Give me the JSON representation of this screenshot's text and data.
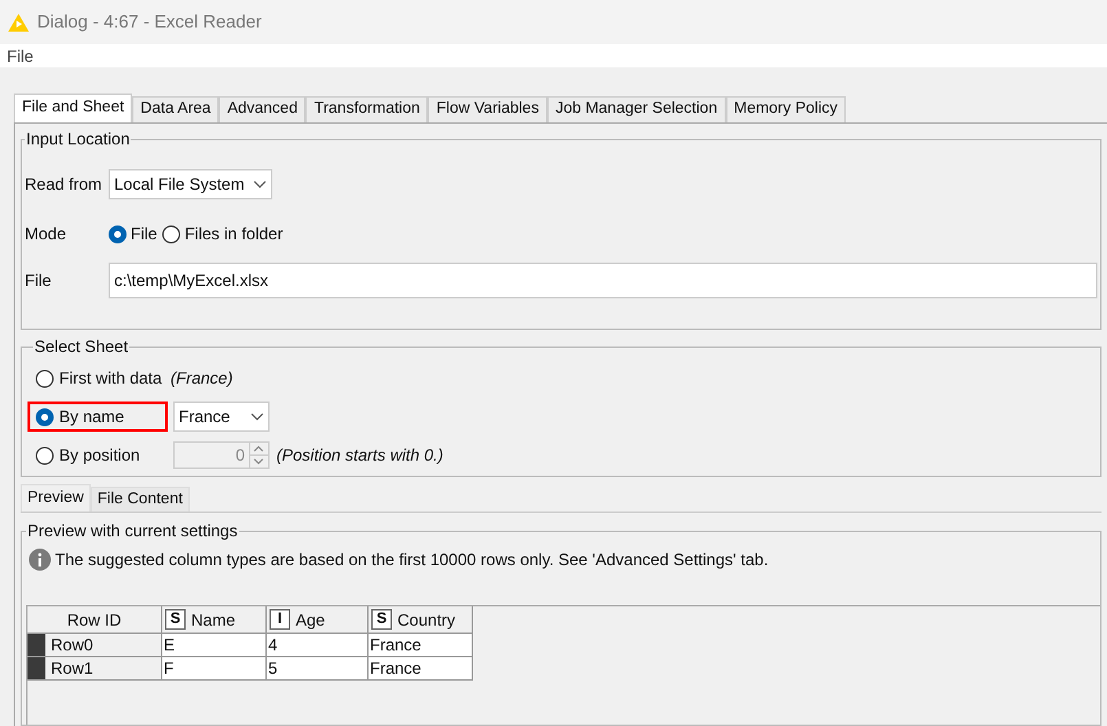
{
  "window": {
    "title": "Dialog - 4:67 - Excel Reader"
  },
  "menu": [
    "File"
  ],
  "tabs": [
    {
      "label": "File and Sheet",
      "selected": true
    },
    {
      "label": "Data Area",
      "selected": false
    },
    {
      "label": "Advanced",
      "selected": false
    },
    {
      "label": "Transformation",
      "selected": false
    },
    {
      "label": "Flow Variables",
      "selected": false
    },
    {
      "label": "Job Manager Selection",
      "selected": false
    },
    {
      "label": "Memory Policy",
      "selected": false
    }
  ],
  "input_location": {
    "legend": "Input Location",
    "read_from": {
      "label": "Read from",
      "value": "Local File System"
    },
    "mode": {
      "label": "Mode",
      "options": [
        {
          "label": "File",
          "selected": true
        },
        {
          "label": "Files in folder",
          "selected": false
        }
      ]
    },
    "file": {
      "label": "File",
      "value": "c:\\temp\\MyExcel.xlsx"
    }
  },
  "select_sheet": {
    "legend": "Select Sheet",
    "options": [
      {
        "kind": "note",
        "label": "First with data",
        "selected": false,
        "highlighted": false,
        "note": "(France)"
      },
      {
        "kind": "dropdown",
        "label": "By name",
        "selected": true,
        "highlighted": true,
        "value": "France"
      },
      {
        "kind": "spinner",
        "label": "By position",
        "selected": false,
        "highlighted": false,
        "value": "0",
        "disabled": true,
        "note": "(Position starts with 0.)"
      }
    ]
  },
  "preview_tabs": [
    {
      "label": "Preview",
      "selected": true
    },
    {
      "label": "File Content",
      "selected": false
    }
  ],
  "preview": {
    "legend": "Preview with current settings",
    "info": "The suggested column types are based on the first 10000 rows only. See 'Advanced Settings' tab.",
    "table": {
      "row_id_header": "Row ID",
      "columns": [
        {
          "type": "S",
          "label": "Name"
        },
        {
          "type": "I",
          "label": "Age"
        },
        {
          "type": "S",
          "label": "Country"
        }
      ],
      "rows": [
        {
          "id": "Row0",
          "cells": [
            "E",
            "4",
            "France"
          ]
        },
        {
          "id": "Row1",
          "cells": [
            "F",
            "5",
            "France"
          ]
        }
      ]
    }
  }
}
